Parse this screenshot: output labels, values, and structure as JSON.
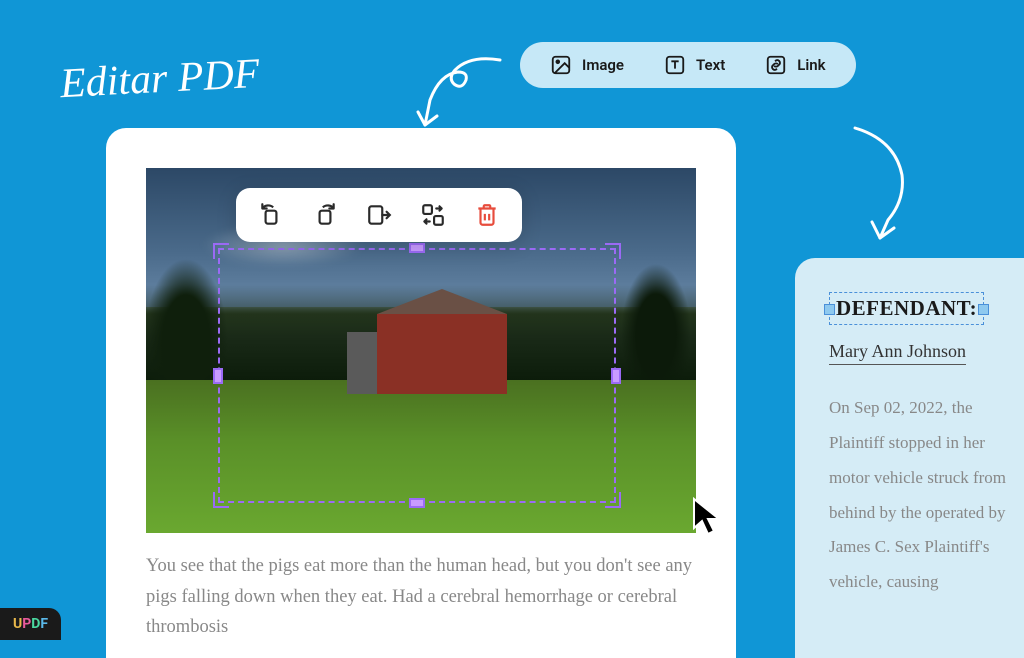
{
  "title": "Editar PDF",
  "toolbar": {
    "image": "Image",
    "text": "Text",
    "link": "Link"
  },
  "image_tools": {
    "rotate_left": "rotate-left",
    "rotate_right": "rotate-right",
    "extract": "extract",
    "replace": "replace",
    "delete": "delete"
  },
  "doc1": {
    "body": "You see that the pigs eat more than the human head, but you don't see any pigs falling down when they eat. Had a cerebral hemorrhage or cerebral thrombosis"
  },
  "doc2": {
    "heading": "DEFENDANT:",
    "name": "Mary Ann Johnson",
    "body": "On Sep 02, 2022, the Plaintiff stopped in her motor vehicle struck from behind by the operated by James C. Sex Plaintiff's vehicle, causing"
  },
  "logo": {
    "u": "U",
    "p": "P",
    "d": "D",
    "f": "F"
  }
}
